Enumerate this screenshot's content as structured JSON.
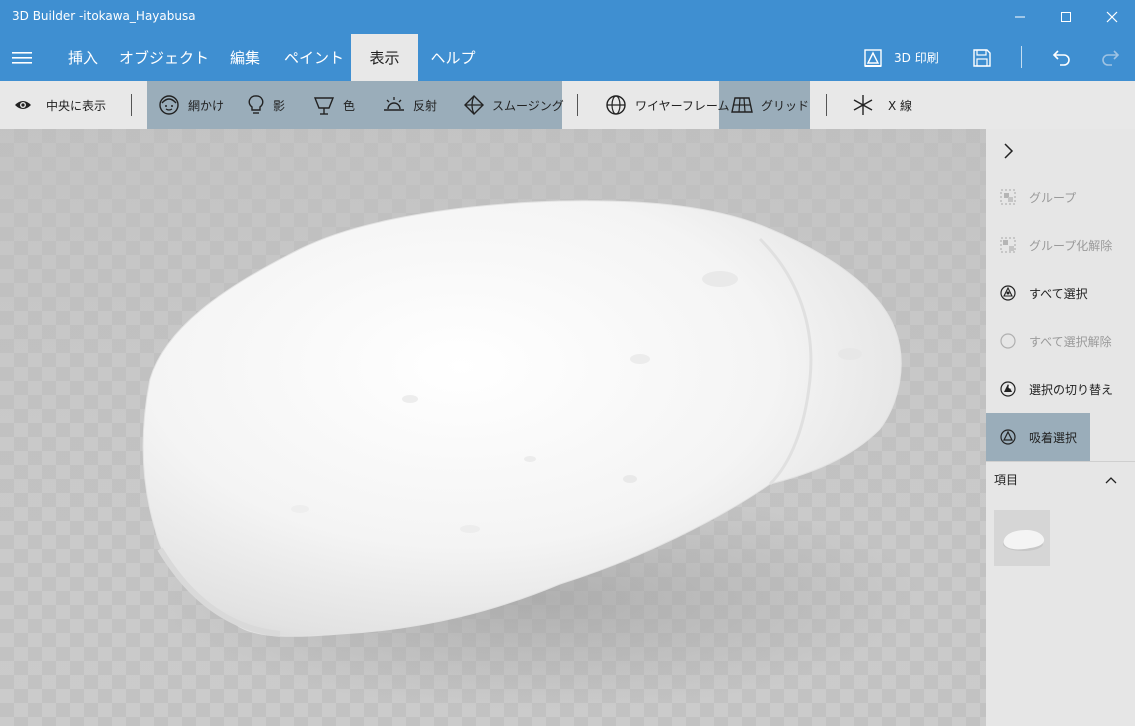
{
  "window": {
    "title": "3D Builder -itokawa_Hayabusa"
  },
  "menu": {
    "items": [
      {
        "label": "挿入"
      },
      {
        "label": "オブジェクト"
      },
      {
        "label": "編集"
      },
      {
        "label": "ペイント"
      },
      {
        "label": "表示",
        "active": true
      },
      {
        "label": "ヘルプ"
      }
    ],
    "print_label": "3D 印刷"
  },
  "toolbar": {
    "center": "中央に表示",
    "shading": "網かけ",
    "shadow": "影",
    "color": "色",
    "reflection": "反射",
    "smoothing": "スムージング",
    "wireframe": "ワイヤーフレーム",
    "grid": "グリッド",
    "xray": "X 線"
  },
  "panel": {
    "group": "グループ",
    "ungroup": "グループ化解除",
    "select_all": "すべて選択",
    "deselect_all": "すべて選択解除",
    "toggle_selection": "選択の切り替え",
    "magnet_select": "吸着選択",
    "items_header": "項目"
  },
  "colors": {
    "accent": "#3f8fd1",
    "toolbar_bg": "#e8e8e8",
    "active_toggle": "#9aadba",
    "viewport_bg": "#c7c7c7"
  }
}
